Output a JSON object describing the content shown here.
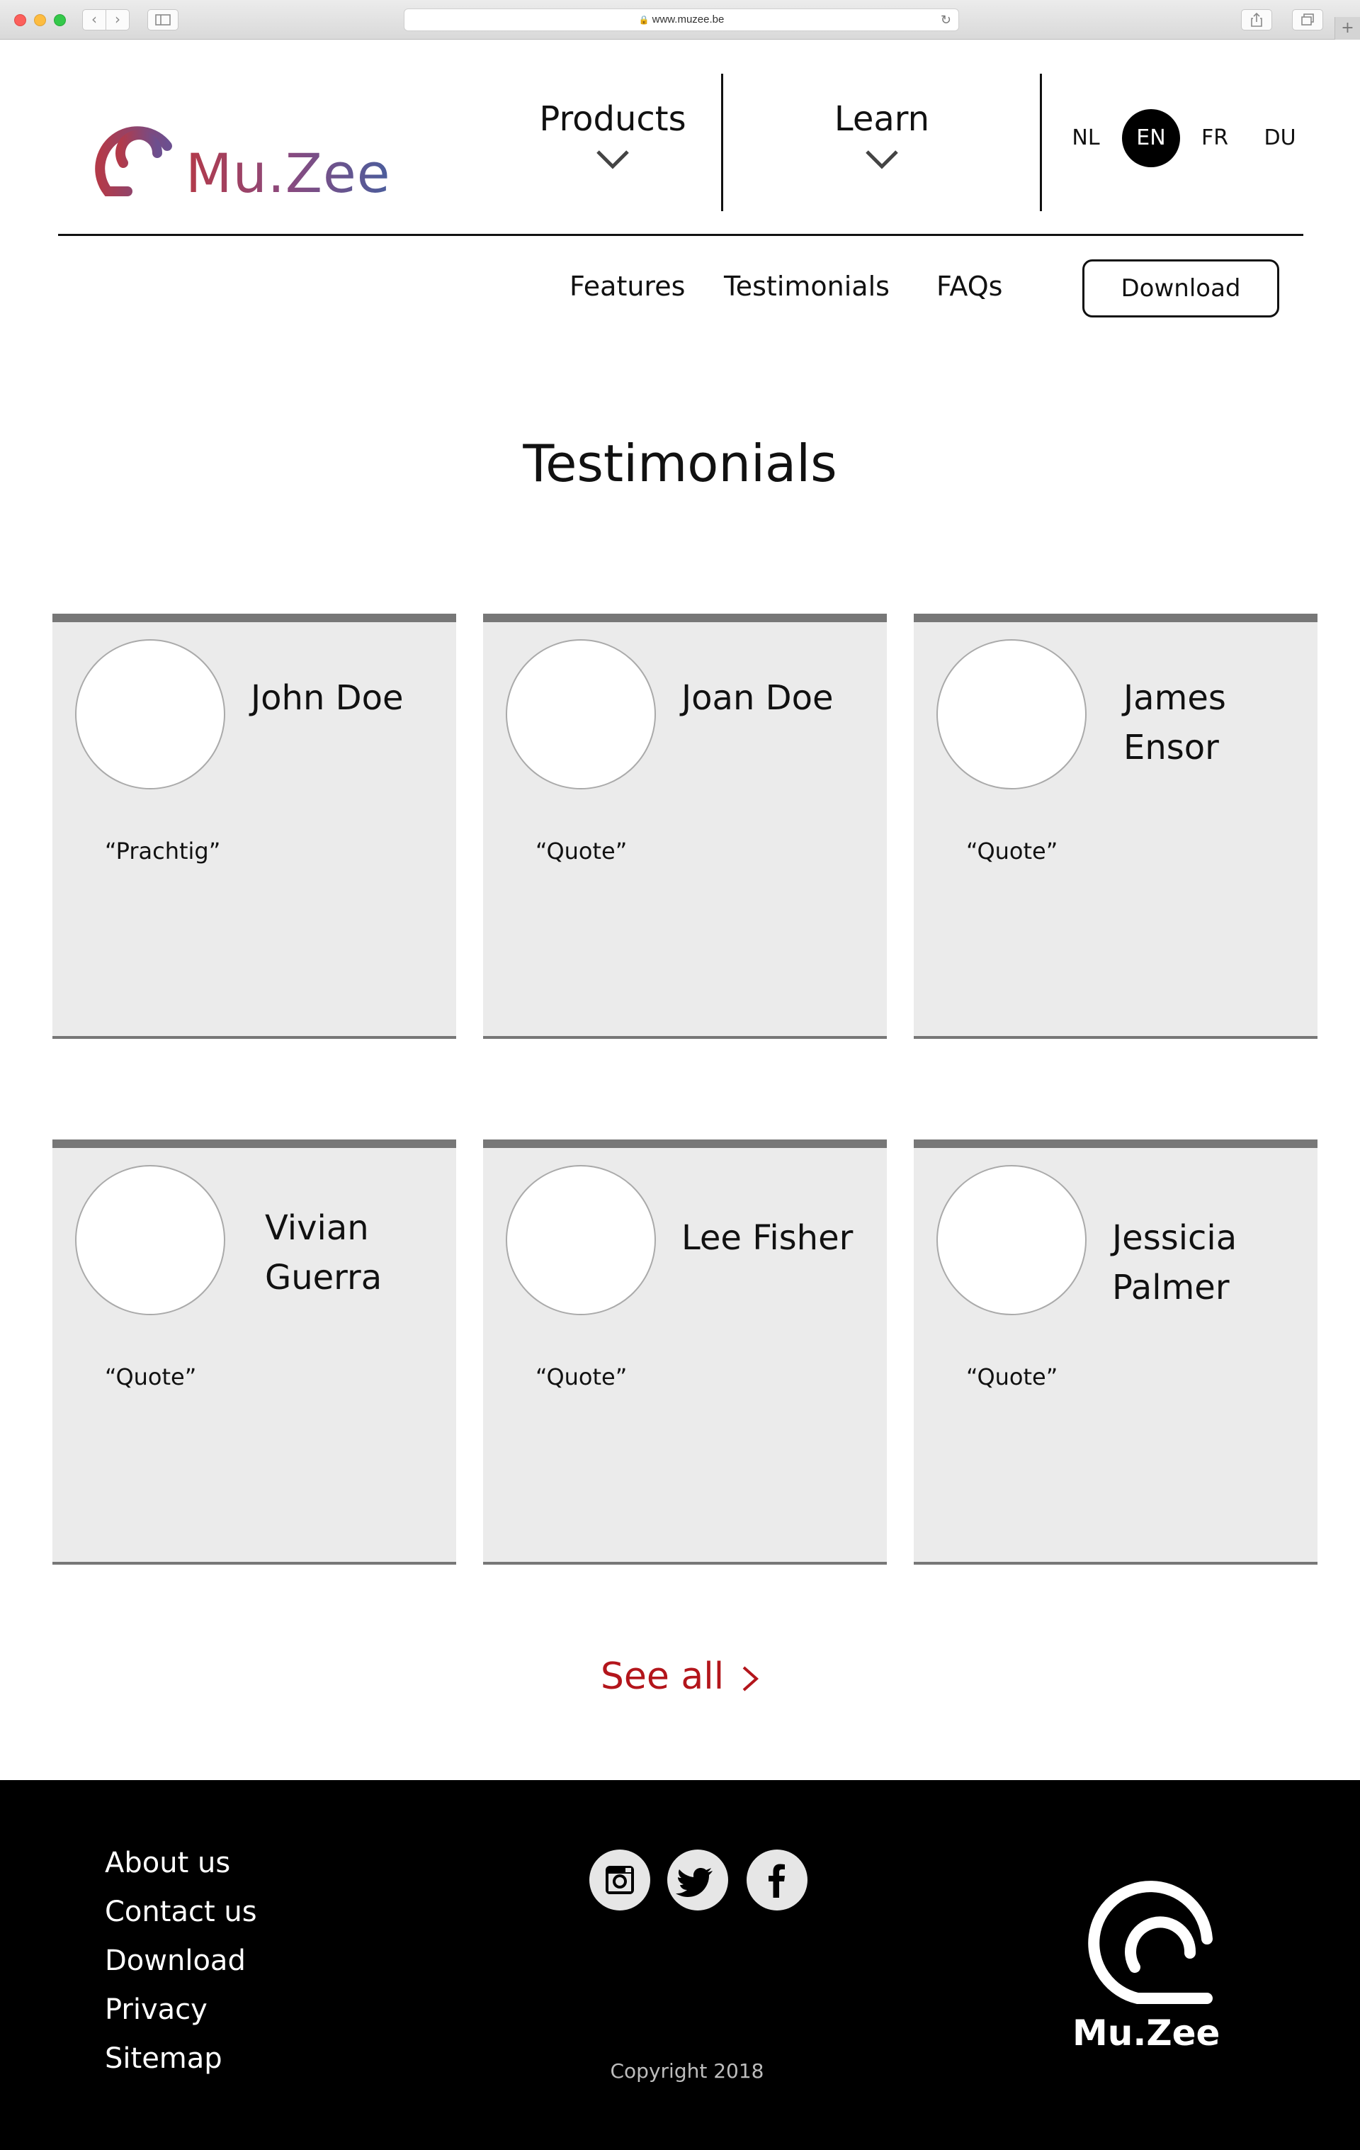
{
  "browser": {
    "url": "www.muzee.be"
  },
  "header": {
    "logo_text": "Mu.Zee",
    "menu": [
      {
        "label": "Products"
      },
      {
        "label": "Learn"
      }
    ],
    "languages": [
      {
        "code": "NL",
        "active": false
      },
      {
        "code": "EN",
        "active": true
      },
      {
        "code": "FR",
        "active": false
      },
      {
        "code": "DU",
        "active": false
      }
    ]
  },
  "subnav": {
    "items": [
      "Features",
      "Testimonials",
      "FAQs"
    ],
    "download_label": "Download"
  },
  "main": {
    "title": "Testimonials",
    "testimonials": [
      {
        "name": "John Doe",
        "quote": "“Prachtig”"
      },
      {
        "name": "Joan Doe",
        "quote": "“Quote”"
      },
      {
        "name": "James Ensor",
        "quote": "“Quote”"
      },
      {
        "name": "Vivian Guerra",
        "quote": "“Quote”"
      },
      {
        "name": "Lee Fisher",
        "quote": "“Quote”"
      },
      {
        "name": "Jessicia Palmer",
        "quote": "“Quote”"
      }
    ],
    "see_all_label": "See all",
    "accent_color": "#b3151b"
  },
  "footer": {
    "links": [
      "About us",
      "Contact us",
      "Download",
      "Privacy",
      "Sitemap"
    ],
    "social": [
      "instagram-icon",
      "twitter-icon",
      "facebook-icon"
    ],
    "copyright": "Copyright 2018",
    "logo_text": "Mu.Zee"
  }
}
